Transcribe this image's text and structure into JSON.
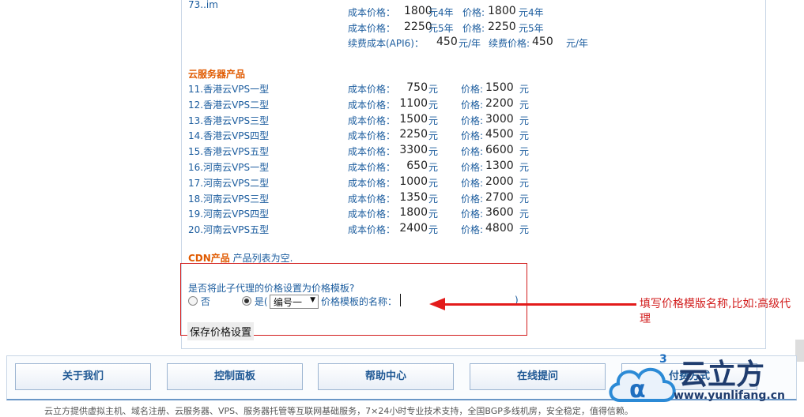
{
  "top_item": {
    "name": "73..im",
    "rows": [
      {
        "label": "成本价格：",
        "cost": "1800",
        "cost_unit": "元4年",
        "price_label": "价格:",
        "price": "1800",
        "price_unit": "元4年"
      },
      {
        "label": "成本价格：",
        "cost": "2250",
        "cost_unit": "元5年",
        "price_label": "价格:",
        "price": "2250",
        "price_unit": "元5年"
      },
      {
        "label": "续费成本(API6)：",
        "cost": "450",
        "cost_unit": "元/年",
        "price_label": "续费价格:",
        "price": "450",
        "price_unit": "元/年"
      }
    ]
  },
  "cloud_section": {
    "title": "云服务器产品",
    "cost_label": "成本价格：",
    "price_label": "价格:",
    "unit": "元",
    "items": [
      {
        "name": "11.香港云VPS一型",
        "cost": "750",
        "price": "1500"
      },
      {
        "name": "12.香港云VPS二型",
        "cost": "1100",
        "price": "2200"
      },
      {
        "name": "13.香港云VPS三型",
        "cost": "1500",
        "price": "3000"
      },
      {
        "name": "14.香港云VPS四型",
        "cost": "2250",
        "price": "4500"
      },
      {
        "name": "15.香港云VPS五型",
        "cost": "3300",
        "price": "6600"
      },
      {
        "name": "16.河南云VPS一型",
        "cost": "650",
        "price": "1300"
      },
      {
        "name": "17.河南云VPS二型",
        "cost": "1000",
        "price": "2000"
      },
      {
        "name": "18.河南云VPS三型",
        "cost": "1350",
        "price": "2700"
      },
      {
        "name": "19.河南云VPS四型",
        "cost": "1800",
        "price": "3600"
      },
      {
        "name": "20.河南云VPS五型",
        "cost": "2400",
        "price": "4800"
      }
    ]
  },
  "cdn": {
    "title": "CDN产品",
    "text": "产品列表为空."
  },
  "template_setting": {
    "question": "是否将此子代理的价格设置为价格模板?",
    "no_label": "否",
    "yes_label": "是(",
    "select_value": "编号一",
    "name_label": "价格模板的名称：",
    "name_value": "",
    "close_paren": ")",
    "save_label": "保存价格设置"
  },
  "annotation": "填写价格模版名称,比如:高级代理",
  "footer": {
    "buttons": [
      "关于我们",
      "控制面板",
      "帮助中心",
      "在线提问",
      "付费方式"
    ],
    "bottom_text": "云立方提供虚拟主机、域名注册、云服务器、VPS、服务器托管等互联网基础服务，7×24小时专业技术支持，全国BGP多线机房，安全稳定，值得信赖。"
  },
  "logo": {
    "name": "云立方",
    "superscript": "3",
    "url": "www.yunlifang.cn"
  },
  "colors": {
    "link": "#1b5c9e",
    "section": "#e05a00",
    "annotation": "#d21d1d",
    "logo": "#1f3c6e"
  }
}
